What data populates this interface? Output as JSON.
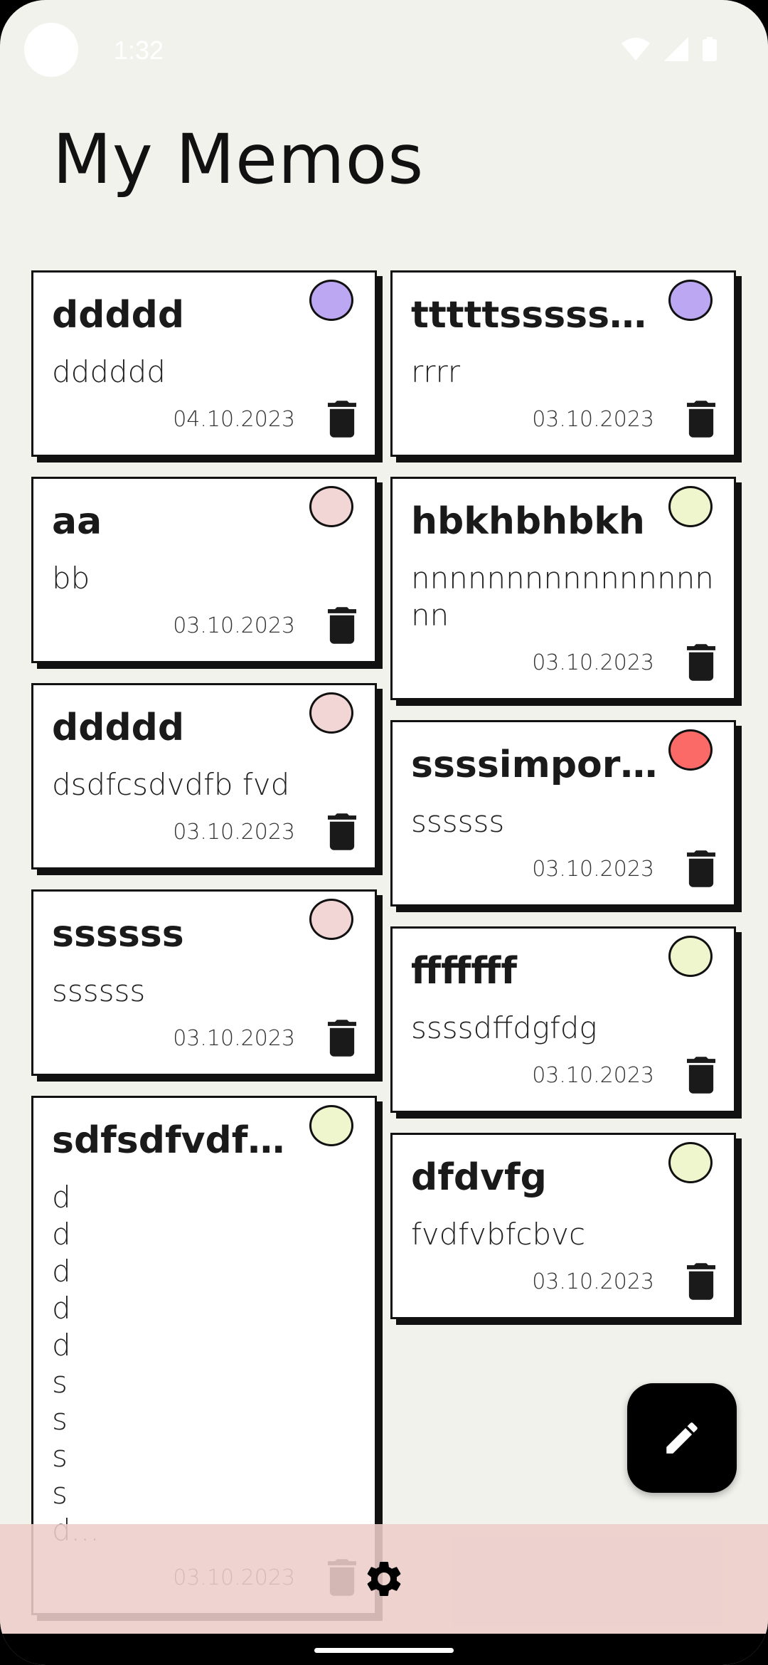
{
  "status_bar": {
    "time": "1:32"
  },
  "page": {
    "title": "My Memos"
  },
  "colors": {
    "purple": "#bba7f2",
    "pink": "#f2d5d5",
    "yellow": "#eff5cd",
    "red": "#fb6a66",
    "background": "#f2f2ed",
    "bottom_bar": "#ecceca"
  },
  "memos_left": [
    {
      "title": "ddddd",
      "body": "dddddd",
      "date": "04.10.2023",
      "color": "#bba7f2"
    },
    {
      "title": "aa",
      "body": "bb",
      "date": "03.10.2023",
      "color": "#f2d5d5"
    },
    {
      "title": "ddddd",
      "body": "dsdfcsdvdfb fvd",
      "date": "03.10.2023",
      "color": "#f2d5d5"
    },
    {
      "title": "ssssss",
      "body": "ssssss",
      "date": "03.10.2023",
      "color": "#f2d5d5"
    },
    {
      "title": "sdfsdfvdfb...",
      "body": "d\nd\nd\nd\nd\ns\ns\ns\ns\nd...",
      "date": "03.10.2023",
      "color": "#eff5cd"
    }
  ],
  "memos_right": [
    {
      "title": "tttttsssssss...",
      "body": "rrrr",
      "date": "03.10.2023",
      "color": "#bba7f2"
    },
    {
      "title": "hbkhbhbkh",
      "body": "nnnnnnnnnnnnnnnnnn",
      "date": "03.10.2023",
      "color": "#eff5cd"
    },
    {
      "title": "ssssimport...",
      "body": "ssssss",
      "date": "03.10.2023",
      "color": "#fb6a66"
    },
    {
      "title": "fffffff",
      "body": "ssssdffdgfdg",
      "date": "03.10.2023",
      "color": "#eff5cd"
    },
    {
      "title": "dfdvfg",
      "body": "fvdfvbfcbvc",
      "date": "03.10.2023",
      "color": "#eff5cd"
    }
  ],
  "fab": {
    "icon": "pencil-icon"
  },
  "bottom_bar": {
    "icon": "gear-icon"
  }
}
